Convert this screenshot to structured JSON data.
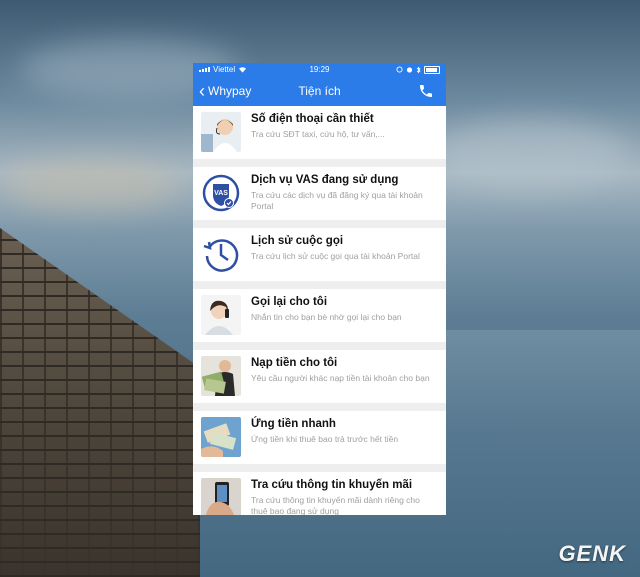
{
  "background": {
    "watermark": "GENK",
    "sky_colors": [
      "#3d5a72",
      "#a8b8c2",
      "#3f6179"
    ]
  },
  "status_bar": {
    "carrier": "Viettel",
    "time": "19:29"
  },
  "nav": {
    "back_label": "Whypay",
    "title": "Tiện ích",
    "call_icon": "phone-icon",
    "color": "#2b7be8"
  },
  "items": [
    {
      "title": "Số điện thoại cần thiết",
      "subtitle": "Tra cứu SĐT taxi, cứu hộ, tư vấn,...",
      "icon": "support-agent"
    },
    {
      "title": "Dịch vụ VAS đang sử dụng",
      "subtitle": "Tra cứu các dịch vụ đã đăng ký qua tài khoản Portal",
      "icon": "vas-shield",
      "icon_text": "VAS"
    },
    {
      "title": "Lịch sử cuộc gọi",
      "subtitle": "Tra cứu lịch sử cuộc gọi qua tài khoản Portal",
      "icon": "history-clock"
    },
    {
      "title": "Gọi lại cho tôi",
      "subtitle": "Nhắn tin cho bạn bè nhờ gọi lại cho bạn",
      "icon": "woman-phone"
    },
    {
      "title": "Nạp tiền cho tôi",
      "subtitle": "Yêu cầu người khác nạp tiền tài khoản cho bạn",
      "icon": "man-money"
    },
    {
      "title": "Ứng tiền nhanh",
      "subtitle": "Ứng tiền khi thuê bao trả trước hết tiền",
      "icon": "money-hands"
    },
    {
      "title": "Tra cứu thông tin khuyến mãi",
      "subtitle": "Tra cứu thông tin khuyến mãi dành riêng cho thuê bao đang sử dụng",
      "icon": "phone-hand"
    }
  ]
}
